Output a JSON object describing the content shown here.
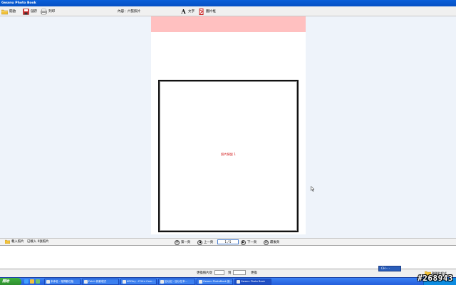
{
  "window": {
    "title": "Gwanu Photo Book"
  },
  "toolbar": {
    "open_label": "開啟",
    "save_label": "儲存",
    "print_label": "列印",
    "content_label": "內容：六張照片",
    "text_label": "文字",
    "frame_label": "圖片框",
    "text_icon_char": "A"
  },
  "page": {
    "header_color": "#ffc0c0",
    "photo_label": "照片預設 1"
  },
  "status": {
    "load_photos_label": "載入照片",
    "loaded_count": "已載入 0張照片",
    "first_label": "第一頁",
    "prev_label": "上一頁",
    "page_indicator": "1 / 5",
    "next_label": "下一頁",
    "last_label": "最後頁"
  },
  "change_row": {
    "label": "更換照片從",
    "to_label": "到",
    "button_label": "更換"
  },
  "ime": {
    "label": "CH ·· ·"
  },
  "exit": {
    "label": "離開此程式"
  },
  "taskbar": {
    "start_label": "開始",
    "tasks": [
      {
        "label": "未命名 - 相簿數位板"
      },
      {
        "label": "Fetch 錄影程式"
      },
      {
        "label": "KRCiby - FOfrn Com..."
      },
      {
        "label": "回以記 - 回以在本..."
      },
      {
        "label": "Gwanu PhotoBook 設..."
      },
      {
        "label": "Gwanu Photo Book"
      }
    ]
  },
  "watermark": "#268943"
}
